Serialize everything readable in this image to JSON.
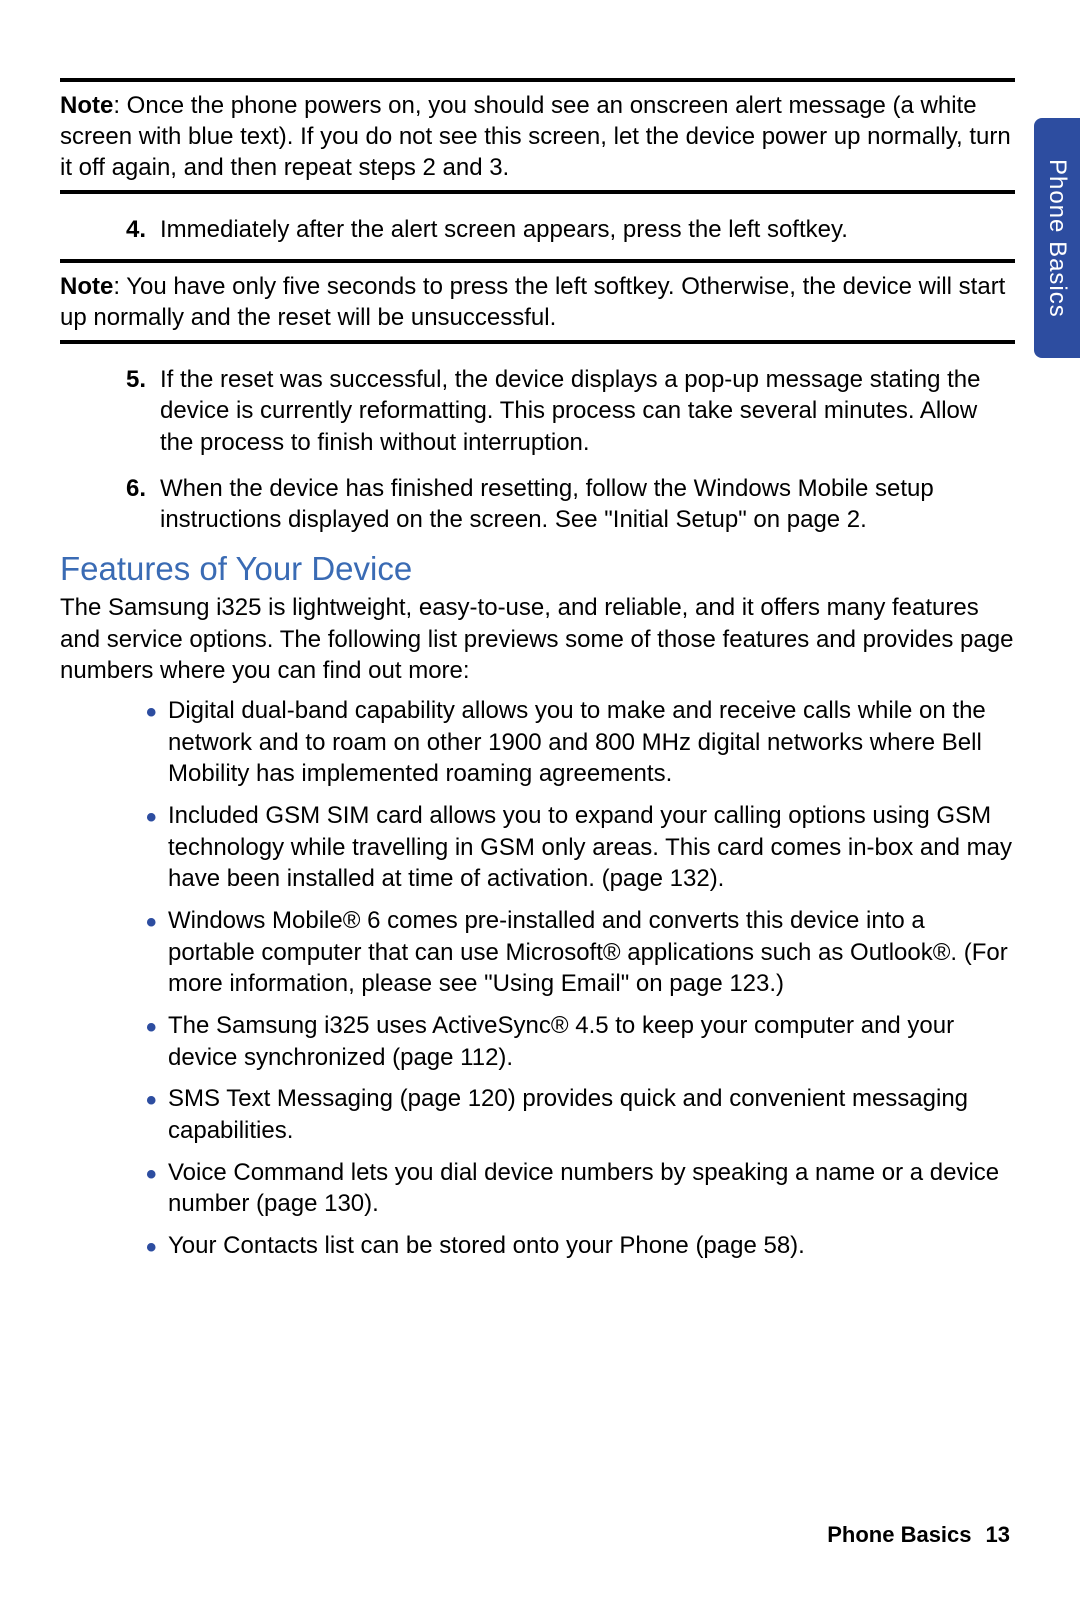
{
  "side_tab": "Phone Basics",
  "note1": {
    "label": "Note",
    "text": ": Once the phone powers on, you should see an onscreen alert message (a white screen with blue text). If you do not see this screen, let the device power up normally, turn it off again, and then repeat steps 2 and 3."
  },
  "step4": {
    "num": "4.",
    "text": "Immediately after the alert screen appears, press the left softkey."
  },
  "note2": {
    "label": "Note",
    "text": ": You have only five seconds to press the left softkey. Otherwise, the device will start up normally and the reset will be unsuccessful."
  },
  "step5": {
    "num": "5.",
    "text": "If the reset was successful, the device displays a pop-up message stating the device is currently reformatting. This process can take several minutes. Allow the process to finish without interruption."
  },
  "step6": {
    "num": "6.",
    "text": "When the device has finished resetting, follow the Windows Mobile setup instructions displayed on the screen. See \"Initial Setup\" on page 2."
  },
  "heading_features": "Features of Your Device",
  "features_intro": "The Samsung i325 is lightweight, easy-to-use, and reliable, and it offers many features and service options. The following list previews some of those features and provides page numbers where you can find out more:",
  "bullets": {
    "b1": "Digital dual-band capability allows you to make and receive calls while on the network and to roam on other 1900 and 800 MHz digital networks where Bell Mobility has implemented roaming agreements.",
    "b2": "Included GSM SIM card allows you to expand your calling options using GSM technology while travelling in GSM only areas. This card comes in-box and may have been installed at time of activation. (page 132).",
    "b3": "Windows Mobile® 6 comes pre-installed and converts this device into a portable computer that can use Microsoft® applications such as Outlook®. (For more information, please see \"Using Email\" on page 123.)",
    "b4": "The Samsung i325 uses ActiveSync® 4.5 to keep your computer and your device synchronized (page 112).",
    "b5": "SMS Text Messaging (page 120) provides quick and convenient messaging capabilities.",
    "b6": "Voice Command lets you dial device numbers by speaking a name or a device number (page 130).",
    "b7": "Your Contacts list can be stored onto your Phone (page 58)."
  },
  "footer": {
    "section": "Phone Basics",
    "page": "13"
  }
}
